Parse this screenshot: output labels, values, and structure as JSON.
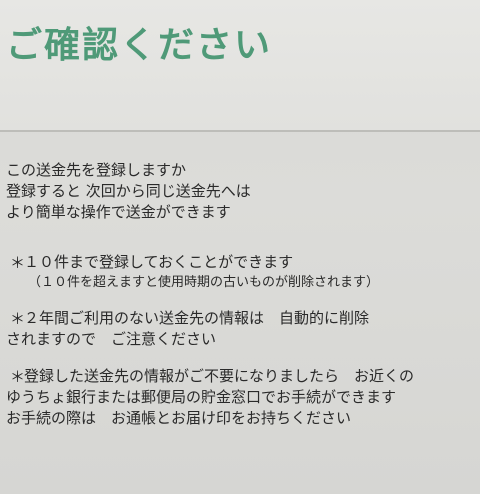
{
  "header": {
    "title": "ご確認ください"
  },
  "intro": {
    "lines": [
      "この送金先を登録しますか",
      "登録すると 次回から同じ送金先へは",
      "より簡単な操作で送金ができます"
    ]
  },
  "notes": {
    "bullet": "＊",
    "note1": {
      "line1": "１０件まで登録しておくことができます",
      "line2": "（１０件を超えますと使用時期の古いものが削除されます）"
    },
    "note2": {
      "line1": "２年間ご利用のない送金先の情報は　自動的に削除",
      "line2": "されますので　ご注意ください"
    },
    "note3": {
      "line1": "登録した送金先の情報がご不要になりましたら　お近くの",
      "line2": "ゆうちょ銀行または郵便局の貯金窓口でお手続ができます",
      "line3": "お手続の際は　お通帳とお届け印をお持ちください"
    }
  }
}
